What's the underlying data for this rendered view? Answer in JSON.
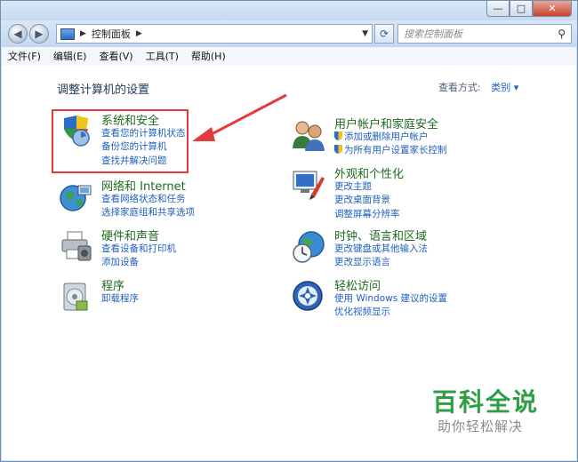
{
  "window": {
    "buttons": {
      "minimize": "—",
      "maximize": "□",
      "close": "✕"
    }
  },
  "nav": {
    "address_segment": "控制面板",
    "search_placeholder": "搜索控制面板"
  },
  "menu": [
    "文件(F)",
    "编辑(E)",
    "查看(V)",
    "工具(T)",
    "帮助(H)"
  ],
  "page": {
    "heading": "调整计算机的设置",
    "view_by_label": "查看方式:",
    "view_by_value": "类别"
  },
  "categories": {
    "security": {
      "title": "系统和安全",
      "links": [
        "查看您的计算机状态",
        "备份您的计算机",
        "查找并解决问题"
      ]
    },
    "network": {
      "title": "网络和 Internet",
      "links": [
        "查看网络状态和任务",
        "选择家庭组和共享选项"
      ]
    },
    "hardware": {
      "title": "硬件和声音",
      "links": [
        "查看设备和打印机",
        "添加设备"
      ]
    },
    "programs": {
      "title": "程序",
      "links": [
        "卸载程序"
      ]
    },
    "users": {
      "title": "用户帐户和家庭安全",
      "links": [
        "添加或删除用户帐户",
        "为所有用户设置家长控制"
      ]
    },
    "appearance": {
      "title": "外观和个性化",
      "links": [
        "更改主题",
        "更改桌面背景",
        "调整屏幕分辨率"
      ]
    },
    "clock": {
      "title": "时钟、语言和区域",
      "links": [
        "更改键盘或其他输入法",
        "更改显示语言"
      ]
    },
    "ease": {
      "title": "轻松访问",
      "links": [
        "使用 Windows 建议的设置",
        "优化视频显示"
      ]
    }
  },
  "watermark": {
    "title": "百科全说",
    "subtitle": "助你轻松解决"
  },
  "colors": {
    "accent": "#1f5fbf",
    "category_title": "#1e6b1e",
    "highlight": "#e23b3b",
    "watermark": "#2f9e44"
  }
}
